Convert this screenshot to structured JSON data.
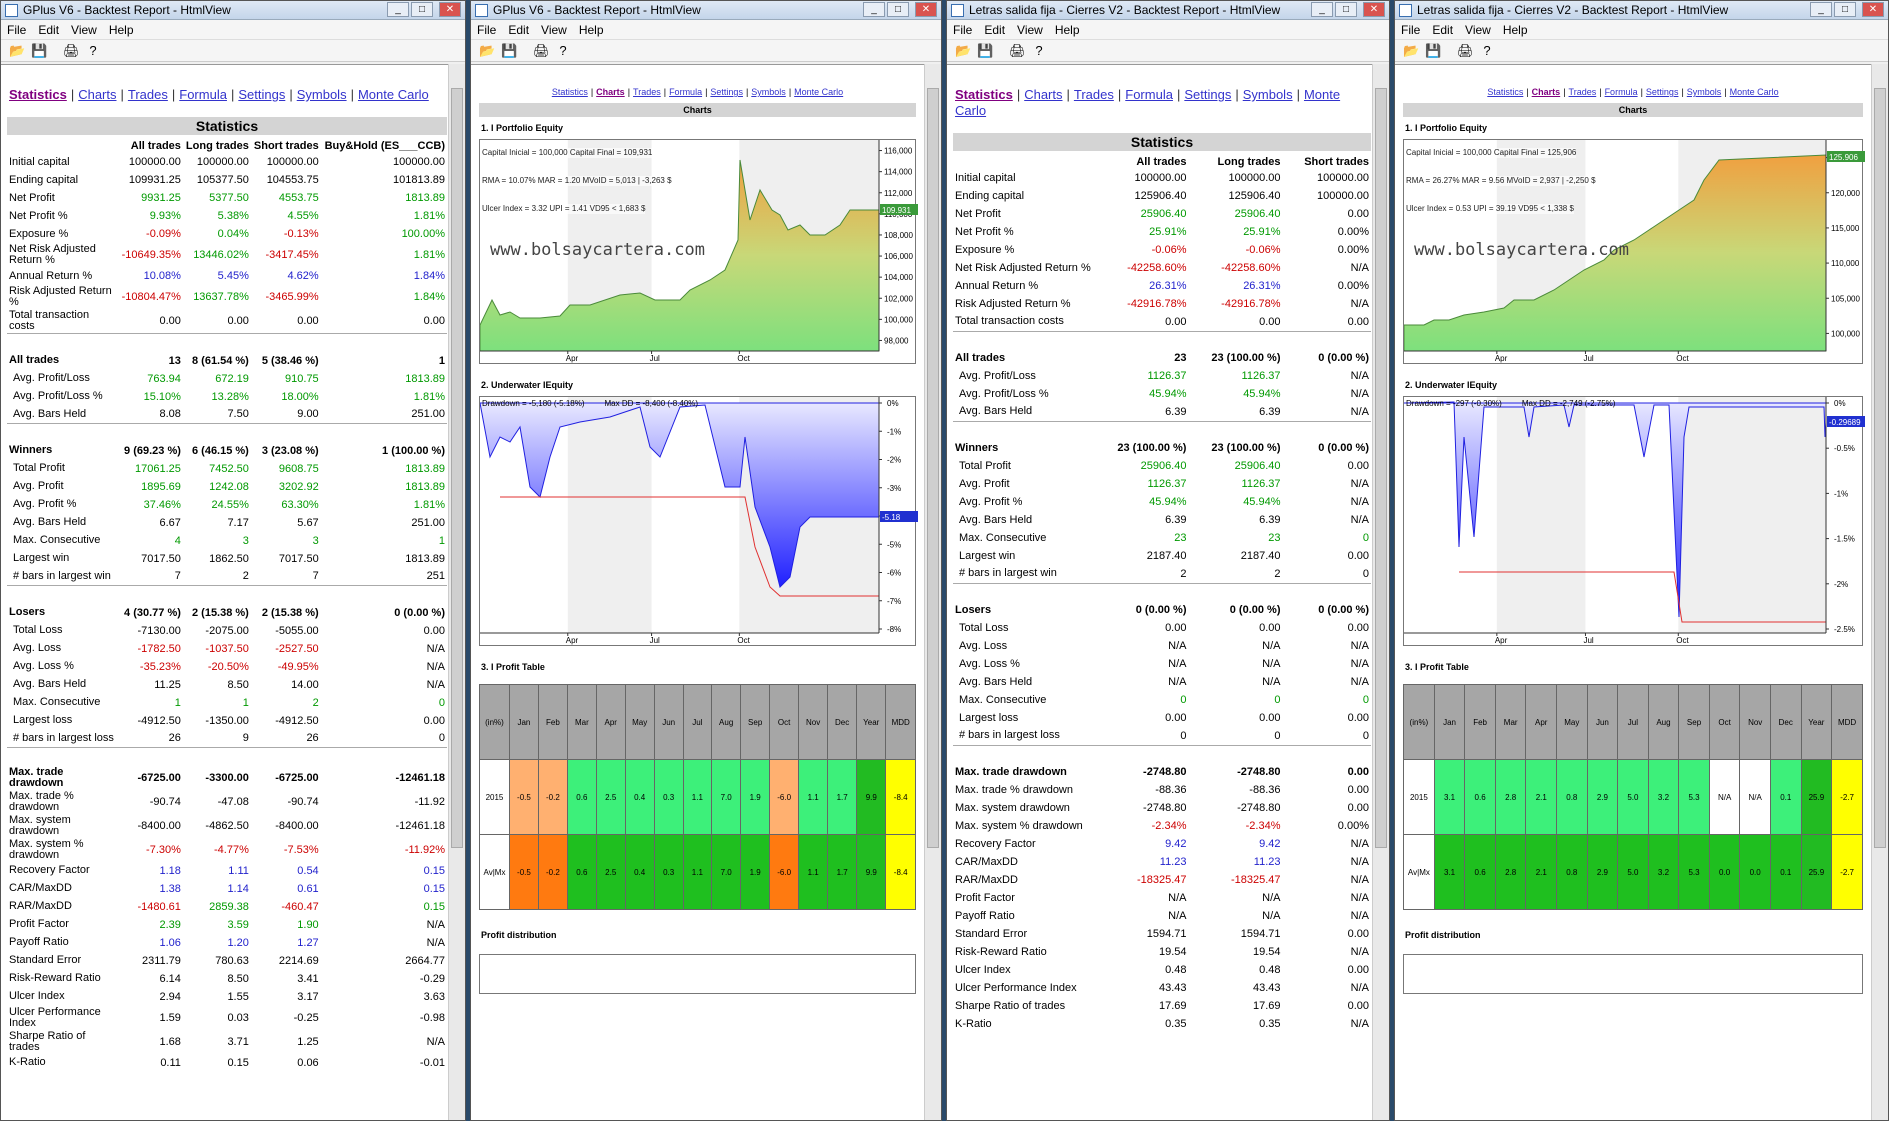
{
  "w1": {
    "title": "GPlus V6 - Backtest Report - HtmlView",
    "menu": [
      "File",
      "Edit",
      "View",
      "Help"
    ],
    "nav": [
      "Statistics",
      "Charts",
      "Trades",
      "Formula",
      "Settings",
      "Symbols",
      "Monte Carlo"
    ],
    "heading": "Statistics",
    "cols": [
      "All trades",
      "Long trades",
      "Short trades",
      "Buy&Hold (ES___CCB)"
    ],
    "rows": [
      [
        "Initial capital",
        "100000.00",
        "100000.00",
        "100000.00",
        "100000.00"
      ],
      [
        "Ending capital",
        "109931.25",
        "105377.50",
        "104553.75",
        "101813.89"
      ],
      [
        "Net Profit",
        "9931.25",
        "5377.50",
        "4553.75",
        "1813.89"
      ],
      [
        "Net Profit %",
        "9.93%",
        "5.38%",
        "4.55%",
        "1.81%"
      ],
      [
        "Exposure %",
        "-0.09%",
        "0.04%",
        "-0.13%",
        "100.00%"
      ],
      [
        "Net Risk Adjusted Return %",
        "-10649.35%",
        "13446.02%",
        "-3417.45%",
        "1.81%"
      ],
      [
        "Annual Return %",
        "10.08%",
        "5.45%",
        "4.62%",
        "1.84%"
      ],
      [
        "Risk Adjusted Return %",
        "-10804.47%",
        "13637.78%",
        "-3465.99%",
        "1.84%"
      ],
      [
        "Total transaction costs",
        "0.00",
        "0.00",
        "0.00",
        "0.00"
      ]
    ],
    "trades": [
      [
        "All trades",
        "13",
        "8 (61.54 %)",
        "5 (38.46 %)",
        "1"
      ],
      [
        "Avg. Profit/Loss",
        "763.94",
        "672.19",
        "910.75",
        "1813.89"
      ],
      [
        "Avg. Profit/Loss %",
        "15.10%",
        "13.28%",
        "18.00%",
        "1.81%"
      ],
      [
        "Avg. Bars Held",
        "8.08",
        "7.50",
        "9.00",
        "251.00"
      ]
    ],
    "winners": [
      [
        "Winners",
        "9 (69.23 %)",
        "6 (46.15 %)",
        "3 (23.08 %)",
        "1 (100.00 %)"
      ],
      [
        "Total Profit",
        "17061.25",
        "7452.50",
        "9608.75",
        "1813.89"
      ],
      [
        "Avg. Profit",
        "1895.69",
        "1242.08",
        "3202.92",
        "1813.89"
      ],
      [
        "Avg. Profit %",
        "37.46%",
        "24.55%",
        "63.30%",
        "1.81%"
      ],
      [
        "Avg. Bars Held",
        "6.67",
        "7.17",
        "5.67",
        "251.00"
      ],
      [
        "Max. Consecutive",
        "4",
        "3",
        "3",
        "1"
      ],
      [
        "Largest win",
        "7017.50",
        "1862.50",
        "7017.50",
        "1813.89"
      ],
      [
        "# bars in largest win",
        "7",
        "2",
        "7",
        "251"
      ]
    ],
    "losers": [
      [
        "Losers",
        "4 (30.77 %)",
        "2 (15.38 %)",
        "2 (15.38 %)",
        "0 (0.00 %)"
      ],
      [
        "Total Loss",
        "-7130.00",
        "-2075.00",
        "-5055.00",
        "0.00"
      ],
      [
        "Avg. Loss",
        "-1782.50",
        "-1037.50",
        "-2527.50",
        "N/A"
      ],
      [
        "Avg. Loss %",
        "-35.23%",
        "-20.50%",
        "-49.95%",
        "N/A"
      ],
      [
        "Avg. Bars Held",
        "11.25",
        "8.50",
        "14.00",
        "N/A"
      ],
      [
        "Max. Consecutive",
        "1",
        "1",
        "2",
        "0"
      ],
      [
        "Largest loss",
        "-4912.50",
        "-1350.00",
        "-4912.50",
        "0.00"
      ],
      [
        "# bars in largest loss",
        "26",
        "9",
        "26",
        "0"
      ]
    ],
    "risk": [
      [
        "Max. trade drawdown",
        "-6725.00",
        "-3300.00",
        "-6725.00",
        "-12461.18"
      ],
      [
        "Max. trade % drawdown",
        "-90.74",
        "-47.08",
        "-90.74",
        "-11.92"
      ],
      [
        "Max. system drawdown",
        "-8400.00",
        "-4862.50",
        "-8400.00",
        "-12461.18"
      ],
      [
        "Max. system % drawdown",
        "-7.30%",
        "-4.77%",
        "-7.53%",
        "-11.92%"
      ],
      [
        "Recovery Factor",
        "1.18",
        "1.11",
        "0.54",
        "0.15"
      ],
      [
        "CAR/MaxDD",
        "1.38",
        "1.14",
        "0.61",
        "0.15"
      ],
      [
        "RAR/MaxDD",
        "-1480.61",
        "2859.38",
        "-460.47",
        "0.15"
      ],
      [
        "Profit Factor",
        "2.39",
        "3.59",
        "1.90",
        "N/A"
      ],
      [
        "Payoff Ratio",
        "1.06",
        "1.20",
        "1.27",
        "N/A"
      ],
      [
        "Standard Error",
        "2311.79",
        "780.63",
        "2214.69",
        "2664.77"
      ],
      [
        "Risk-Reward Ratio",
        "6.14",
        "8.50",
        "3.41",
        "-0.29"
      ],
      [
        "Ulcer Index",
        "2.94",
        "1.55",
        "3.17",
        "3.63"
      ],
      [
        "Ulcer Performance Index",
        "1.59",
        "0.03",
        "-0.25",
        "-0.98"
      ],
      [
        "Sharpe Ratio of trades",
        "1.68",
        "3.71",
        "1.25",
        "N/A"
      ],
      [
        "K-Ratio",
        "0.11",
        "0.15",
        "0.06",
        "-0.01"
      ]
    ]
  },
  "w2": {
    "title": "GPlus V6 - Backtest Report - HtmlView",
    "menu": [
      "File",
      "Edit",
      "View",
      "Help"
    ],
    "nav": [
      "Statistics",
      "Charts",
      "Trades",
      "Formula",
      "Settings",
      "Symbols",
      "Monte Carlo"
    ],
    "heading": "Charts",
    "s1": "1. I Portfolio Equity",
    "s2": "2. Underwater IEquity",
    "s3": "3. I Profit Table",
    "s4": "Profit distribution",
    "eqinfo": [
      "Capital Inicial = 100,000   Capital Final = 109,931",
      "RMA = 10.07%   MAR = 1.20   MVoID = 5,013 | -3,263 $",
      "Ulcer Index = 3.32   UPI = 1.41   VD95 < 1,683 $"
    ],
    "watermark": "www.bolsaycartera.com",
    "eqticks": [
      "116,000",
      "114,000",
      "112,000",
      "110,000",
      "108,000",
      "106,000",
      "104,000",
      "102,000",
      "100,000",
      "98,000"
    ],
    "eqlast": "109.931",
    "xticks": [
      "Apr",
      "Jul",
      "Oct"
    ],
    "ddinfo": "Drawdown = -5,180 (-5.18%)         Max DD = -8,400 (-8.40%)",
    "ddticks": [
      "0%",
      "-1%",
      "-2%",
      "-3%",
      "-4%",
      "-5%",
      "-6%",
      "-7%",
      "-8%"
    ],
    "ddlast": "-5.18",
    "pthead": [
      "(in%)",
      "Jan",
      "Feb",
      "Mar",
      "Apr",
      "May",
      "Jun",
      "Jul",
      "Aug",
      "Sep",
      "Oct",
      "Nov",
      "Dec",
      "Year",
      "MDD"
    ],
    "pt2015": [
      "2015",
      "-0.5",
      "-0.2",
      "0.6",
      "2.5",
      "0.4",
      "0.3",
      "1.1",
      "7.0",
      "1.9",
      "-6.0",
      "1.1",
      "1.7",
      "9.9",
      "-8.4"
    ],
    "ptavg": [
      "Av|Mx",
      "-0.5",
      "-0.2",
      "0.6",
      "2.5",
      "0.4",
      "0.3",
      "1.1",
      "7.0",
      "1.9",
      "-6.0",
      "1.1",
      "1.7",
      "9.9",
      "-8.4"
    ]
  },
  "w3": {
    "title": "Letras salida fija - Cierres V2 - Backtest Report - HtmlView",
    "menu": [
      "File",
      "Edit",
      "View",
      "Help"
    ],
    "nav": [
      "Statistics",
      "Charts",
      "Trades",
      "Formula",
      "Settings",
      "Symbols",
      "Monte Carlo"
    ],
    "heading": "Statistics",
    "cols": [
      "All trades",
      "Long trades",
      "Short trades"
    ],
    "rows": [
      [
        "Initial capital",
        "100000.00",
        "100000.00",
        "100000.00"
      ],
      [
        "Ending capital",
        "125906.40",
        "125906.40",
        "100000.00"
      ],
      [
        "Net Profit",
        "25906.40",
        "25906.40",
        "0.00"
      ],
      [
        "Net Profit %",
        "25.91%",
        "25.91%",
        "0.00%"
      ],
      [
        "Exposure %",
        "-0.06%",
        "-0.06%",
        "0.00%"
      ],
      [
        "Net Risk Adjusted Return %",
        "-42258.60%",
        "-42258.60%",
        "N/A"
      ],
      [
        "Annual Return %",
        "26.31%",
        "26.31%",
        "0.00%"
      ],
      [
        "Risk Adjusted Return %",
        "-42916.78%",
        "-42916.78%",
        "N/A"
      ],
      [
        "Total transaction costs",
        "0.00",
        "0.00",
        "0.00"
      ]
    ],
    "trades": [
      [
        "All trades",
        "23",
        "23 (100.00 %)",
        "0 (0.00 %)"
      ],
      [
        "Avg. Profit/Loss",
        "1126.37",
        "1126.37",
        "N/A"
      ],
      [
        "Avg. Profit/Loss %",
        "45.94%",
        "45.94%",
        "N/A"
      ],
      [
        "Avg. Bars Held",
        "6.39",
        "6.39",
        "N/A"
      ]
    ],
    "winners": [
      [
        "Winners",
        "23 (100.00 %)",
        "23 (100.00 %)",
        "0 (0.00 %)"
      ],
      [
        "Total Profit",
        "25906.40",
        "25906.40",
        "0.00"
      ],
      [
        "Avg. Profit",
        "1126.37",
        "1126.37",
        "N/A"
      ],
      [
        "Avg. Profit %",
        "45.94%",
        "45.94%",
        "N/A"
      ],
      [
        "Avg. Bars Held",
        "6.39",
        "6.39",
        "N/A"
      ],
      [
        "Max. Consecutive",
        "23",
        "23",
        "0"
      ],
      [
        "Largest win",
        "2187.40",
        "2187.40",
        "0.00"
      ],
      [
        "# bars in largest win",
        "2",
        "2",
        "0"
      ]
    ],
    "losers": [
      [
        "Losers",
        "0 (0.00 %)",
        "0 (0.00 %)",
        "0 (0.00 %)"
      ],
      [
        "Total Loss",
        "0.00",
        "0.00",
        "0.00"
      ],
      [
        "Avg. Loss",
        "N/A",
        "N/A",
        "N/A"
      ],
      [
        "Avg. Loss %",
        "N/A",
        "N/A",
        "N/A"
      ],
      [
        "Avg. Bars Held",
        "N/A",
        "N/A",
        "N/A"
      ],
      [
        "Max. Consecutive",
        "0",
        "0",
        "0"
      ],
      [
        "Largest loss",
        "0.00",
        "0.00",
        "0.00"
      ],
      [
        "# bars in largest loss",
        "0",
        "0",
        "0"
      ]
    ],
    "risk": [
      [
        "Max. trade drawdown",
        "-2748.80",
        "-2748.80",
        "0.00"
      ],
      [
        "Max. trade % drawdown",
        "-88.36",
        "-88.36",
        "0.00"
      ],
      [
        "Max. system drawdown",
        "-2748.80",
        "-2748.80",
        "0.00"
      ],
      [
        "Max. system % drawdown",
        "-2.34%",
        "-2.34%",
        "0.00%"
      ],
      [
        "Recovery Factor",
        "9.42",
        "9.42",
        "N/A"
      ],
      [
        "CAR/MaxDD",
        "11.23",
        "11.23",
        "N/A"
      ],
      [
        "RAR/MaxDD",
        "-18325.47",
        "-18325.47",
        "N/A"
      ],
      [
        "Profit Factor",
        "N/A",
        "N/A",
        "N/A"
      ],
      [
        "Payoff Ratio",
        "N/A",
        "N/A",
        "N/A"
      ],
      [
        "Standard Error",
        "1594.71",
        "1594.71",
        "0.00"
      ],
      [
        "Risk-Reward Ratio",
        "19.54",
        "19.54",
        "N/A"
      ],
      [
        "Ulcer Index",
        "0.48",
        "0.48",
        "0.00"
      ],
      [
        "Ulcer Performance Index",
        "43.43",
        "43.43",
        "N/A"
      ],
      [
        "Sharpe Ratio of trades",
        "17.69",
        "17.69",
        "0.00"
      ],
      [
        "K-Ratio",
        "0.35",
        "0.35",
        "N/A"
      ]
    ]
  },
  "w4": {
    "title": "Letras salida fija - Cierres V2 - Backtest Report - HtmlView",
    "menu": [
      "File",
      "Edit",
      "View",
      "Help"
    ],
    "nav": [
      "Statistics",
      "Charts",
      "Trades",
      "Formula",
      "Settings",
      "Symbols",
      "Monte Carlo"
    ],
    "heading": "Charts",
    "s1": "1. I Portfolio Equity",
    "s2": "2. Underwater IEquity",
    "s3": "3. I Profit Table",
    "s4": "Profit distribution",
    "eqinfo": [
      "Capital Inicial = 100,000   Capital Final = 125,906",
      "RMA = 26.27%   MAR = 9.56   MVoID = 2,937 | -2,250 $",
      "Ulcer Index = 0.53   UPI = 39.19   VD95 < 1,338 $"
    ],
    "watermark": "www.bolsaycartera.com",
    "eqticks": [
      "125,000",
      "120,000",
      "115,000",
      "110,000",
      "105,000",
      "100,000"
    ],
    "eqlast": "125.906",
    "xticks": [
      "Apr",
      "Jul",
      "Oct"
    ],
    "ddinfo": "Drawdown = -297 (-0.30%)         Max DD = -2,749 (-2.75%)",
    "ddticks": [
      "0%",
      "-0.5%",
      "-1%",
      "-1.5%",
      "-2%",
      "-2.5%"
    ],
    "ddlast": "-0.29689",
    "pthead": [
      "(in%)",
      "Jan",
      "Feb",
      "Mar",
      "Apr",
      "May",
      "Jun",
      "Jul",
      "Aug",
      "Sep",
      "Oct",
      "Nov",
      "Dec",
      "Year",
      "MDD"
    ],
    "pt2015": [
      "2015",
      "3.1",
      "0.6",
      "2.8",
      "2.1",
      "0.8",
      "2.9",
      "5.0",
      "3.2",
      "5.3",
      "N/A",
      "N/A",
      "0.1",
      "25.9",
      "-2.7"
    ],
    "ptavg": [
      "Av|Mx",
      "3.1",
      "0.6",
      "2.8",
      "2.1",
      "0.8",
      "2.9",
      "5.0",
      "3.2",
      "5.3",
      "0.0",
      "0.0",
      "0.1",
      "25.9",
      "-2.7"
    ]
  }
}
